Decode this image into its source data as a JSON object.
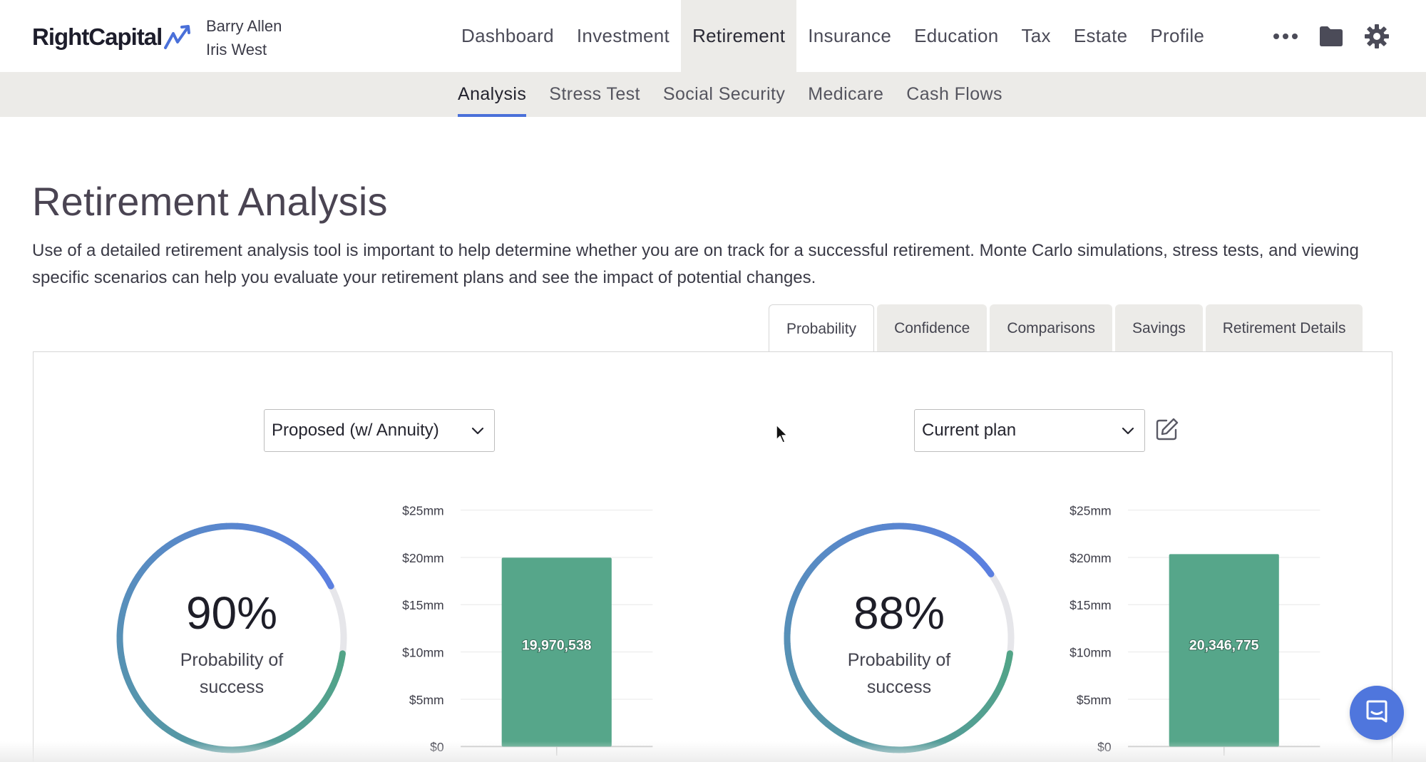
{
  "brand": {
    "name": "RightCapital"
  },
  "clients": [
    "Barry Allen",
    "Iris West"
  ],
  "main_nav": [
    {
      "label": "Dashboard",
      "active": false
    },
    {
      "label": "Investment",
      "active": false
    },
    {
      "label": "Retirement",
      "active": true
    },
    {
      "label": "Insurance",
      "active": false
    },
    {
      "label": "Education",
      "active": false
    },
    {
      "label": "Tax",
      "active": false
    },
    {
      "label": "Estate",
      "active": false
    },
    {
      "label": "Profile",
      "active": false
    }
  ],
  "nav_icons": [
    "more-icon",
    "folder-icon",
    "gear-icon"
  ],
  "sub_nav": [
    {
      "label": "Analysis",
      "active": true
    },
    {
      "label": "Stress Test",
      "active": false
    },
    {
      "label": "Social Security",
      "active": false
    },
    {
      "label": "Medicare",
      "active": false
    },
    {
      "label": "Cash Flows",
      "active": false
    }
  ],
  "page": {
    "title": "Retirement Analysis",
    "description": "Use of a detailed retirement analysis tool is important to help determine whether you are on track for a successful retirement. Monte Carlo simulations, stress tests, and viewing specific scenarios can help you evaluate your retirement plans and see the impact of potential changes."
  },
  "tabs": [
    {
      "label": "Probability",
      "active": true
    },
    {
      "label": "Confidence",
      "active": false
    },
    {
      "label": "Comparisons",
      "active": false
    },
    {
      "label": "Savings",
      "active": false
    },
    {
      "label": "Retirement Details",
      "active": false
    }
  ],
  "left": {
    "select_value": "Proposed (w/ Annuity)",
    "probability": 90,
    "probability_text": "90%",
    "probability_label": "Probability of success"
  },
  "right": {
    "select_value": "Current plan",
    "probability": 88,
    "probability_text": "88%",
    "probability_label": "Probability of success"
  },
  "colors": {
    "accent_blue": "#4a70d9",
    "gauge_start": "#5b7fe0",
    "gauge_end": "#52a487",
    "gauge_track": "#e6e6ea",
    "bar_green": "#56a68a"
  },
  "chart_data": [
    {
      "type": "bar",
      "categories": [
        ""
      ],
      "values": [
        19970538
      ],
      "value_labels": [
        "19,970,538"
      ],
      "yticks": [
        "$0",
        "$5mm",
        "$10mm",
        "$15mm",
        "$20mm",
        "$25mm"
      ],
      "ylim": [
        0,
        25000000
      ],
      "grid": true
    },
    {
      "type": "bar",
      "categories": [
        ""
      ],
      "values": [
        20346775
      ],
      "value_labels": [
        "20,346,775"
      ],
      "yticks": [
        "$0",
        "$5mm",
        "$10mm",
        "$15mm",
        "$20mm",
        "$25mm"
      ],
      "ylim": [
        0,
        25000000
      ],
      "grid": true
    }
  ]
}
